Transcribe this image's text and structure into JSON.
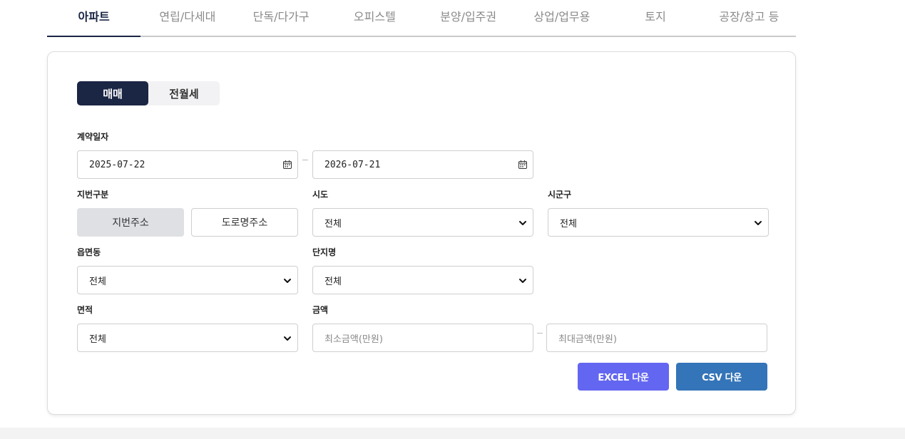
{
  "property_tabs": [
    {
      "label": "아파트",
      "active": true
    },
    {
      "label": "연립/다세대",
      "active": false
    },
    {
      "label": "단독/다가구",
      "active": false
    },
    {
      "label": "오피스텔",
      "active": false
    },
    {
      "label": "분양/입주권",
      "active": false
    },
    {
      "label": "상업/업무용",
      "active": false
    },
    {
      "label": "토지",
      "active": false
    },
    {
      "label": "공장/창고 등",
      "active": false
    }
  ],
  "deal_type": {
    "options": [
      "매매",
      "전월세"
    ],
    "selected": "매매"
  },
  "contract_date": {
    "label": "계약일자",
    "start": "2025-07-22",
    "end": "2026-07-21"
  },
  "address_type": {
    "label": "지번구분",
    "options": [
      "지번주소",
      "도로명주소"
    ],
    "selected": "지번주소"
  },
  "sido": {
    "label": "시도",
    "value": "전체"
  },
  "sigungu": {
    "label": "시군구",
    "value": "전체"
  },
  "eupmyeondong": {
    "label": "읍면동",
    "value": "전체"
  },
  "complex": {
    "label": "단지명",
    "value": "전체"
  },
  "area": {
    "label": "면적",
    "value": "전체"
  },
  "price": {
    "label": "금액",
    "min_placeholder": "최소금액(만원)",
    "max_placeholder": "최대금액(만원)"
  },
  "actions": {
    "excel_label": "EXCEL 다운",
    "csv_label": "CSV 다운"
  },
  "colors": {
    "primary_navy": "#1b2544",
    "excel_button": "#6366f1",
    "csv_button": "#3474b8"
  }
}
